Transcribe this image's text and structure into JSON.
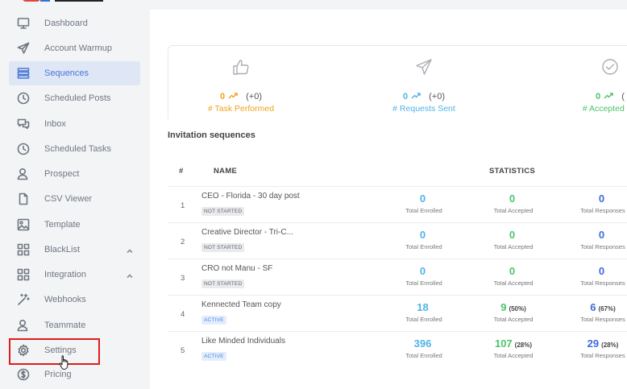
{
  "sidebar": {
    "items": [
      {
        "label": "Dashboard",
        "icon": "monitor-icon"
      },
      {
        "label": "Account Warmup",
        "icon": "send-icon"
      },
      {
        "label": "Sequences",
        "icon": "list-icon",
        "active": true
      },
      {
        "label": "Scheduled Posts",
        "icon": "clock-icon"
      },
      {
        "label": "Inbox",
        "icon": "chat-icon"
      },
      {
        "label": "Scheduled Tasks",
        "icon": "clock-icon"
      },
      {
        "label": "Prospect",
        "icon": "user-icon"
      },
      {
        "label": "CSV Viewer",
        "icon": "file-icon"
      },
      {
        "label": "Template",
        "icon": "image-icon"
      },
      {
        "label": "BlackList",
        "icon": "grid-icon",
        "expandable": true
      },
      {
        "label": "Integration",
        "icon": "grid-icon",
        "expandable": true
      },
      {
        "label": "Webhooks",
        "icon": "magic-wand-icon"
      },
      {
        "label": "Teammate",
        "icon": "user-icon"
      },
      {
        "label": "Settings",
        "icon": "gear-icon"
      },
      {
        "label": "Pricing",
        "icon": "dollar-icon"
      }
    ]
  },
  "stats": [
    {
      "icon": "thumbs-up-icon",
      "value": "0",
      "delta": "(+0)",
      "label": "# Task Performed",
      "color": "#f0a21a"
    },
    {
      "icon": "send-icon",
      "value": "0",
      "delta": "(+0)",
      "label": "# Requests Sent",
      "color": "#4fb3e8"
    },
    {
      "icon": "check-circle-icon",
      "value": "0",
      "delta": "(",
      "label": "# Accepted Re",
      "color": "#4cc46a"
    }
  ],
  "section": {
    "title": "Invitation sequences"
  },
  "table": {
    "headers": {
      "index": "#",
      "name": "NAME",
      "statistics": "STATISTICS"
    },
    "metric_labels": {
      "enrolled": "Total Enrolled",
      "accepted": "Total Accepted",
      "responses": "Total Responses"
    },
    "colors": {
      "enrolled": "#4fb3e8",
      "accepted": "#4cc46a",
      "responses": "#3f6ad8"
    },
    "rows": [
      {
        "index": "1",
        "name": "CEO - Florida - 30 day post",
        "status": "NOT STARTED",
        "enrolled": "0",
        "enrolled_pct": "",
        "accepted": "0",
        "accepted_pct": "",
        "responses": "0",
        "responses_pct": ""
      },
      {
        "index": "2",
        "name": "Creative Director - Tri-C...",
        "status": "NOT STARTED",
        "enrolled": "0",
        "enrolled_pct": "",
        "accepted": "0",
        "accepted_pct": "",
        "responses": "0",
        "responses_pct": ""
      },
      {
        "index": "3",
        "name": "CRO not Manu - SF",
        "status": "NOT STARTED",
        "enrolled": "0",
        "enrolled_pct": "",
        "accepted": "0",
        "accepted_pct": "",
        "responses": "0",
        "responses_pct": ""
      },
      {
        "index": "4",
        "name": "Kennected Team copy",
        "status": "ACTIVE",
        "enrolled": "18",
        "enrolled_pct": "",
        "accepted": "9",
        "accepted_pct": "(50%)",
        "responses": "6",
        "responses_pct": "(67%)"
      },
      {
        "index": "5",
        "name": "Like Minded Individuals",
        "status": "ACTIVE",
        "enrolled": "396",
        "enrolled_pct": "",
        "accepted": "107",
        "accepted_pct": "(28%)",
        "responses": "29",
        "responses_pct": "(28%)"
      }
    ]
  }
}
